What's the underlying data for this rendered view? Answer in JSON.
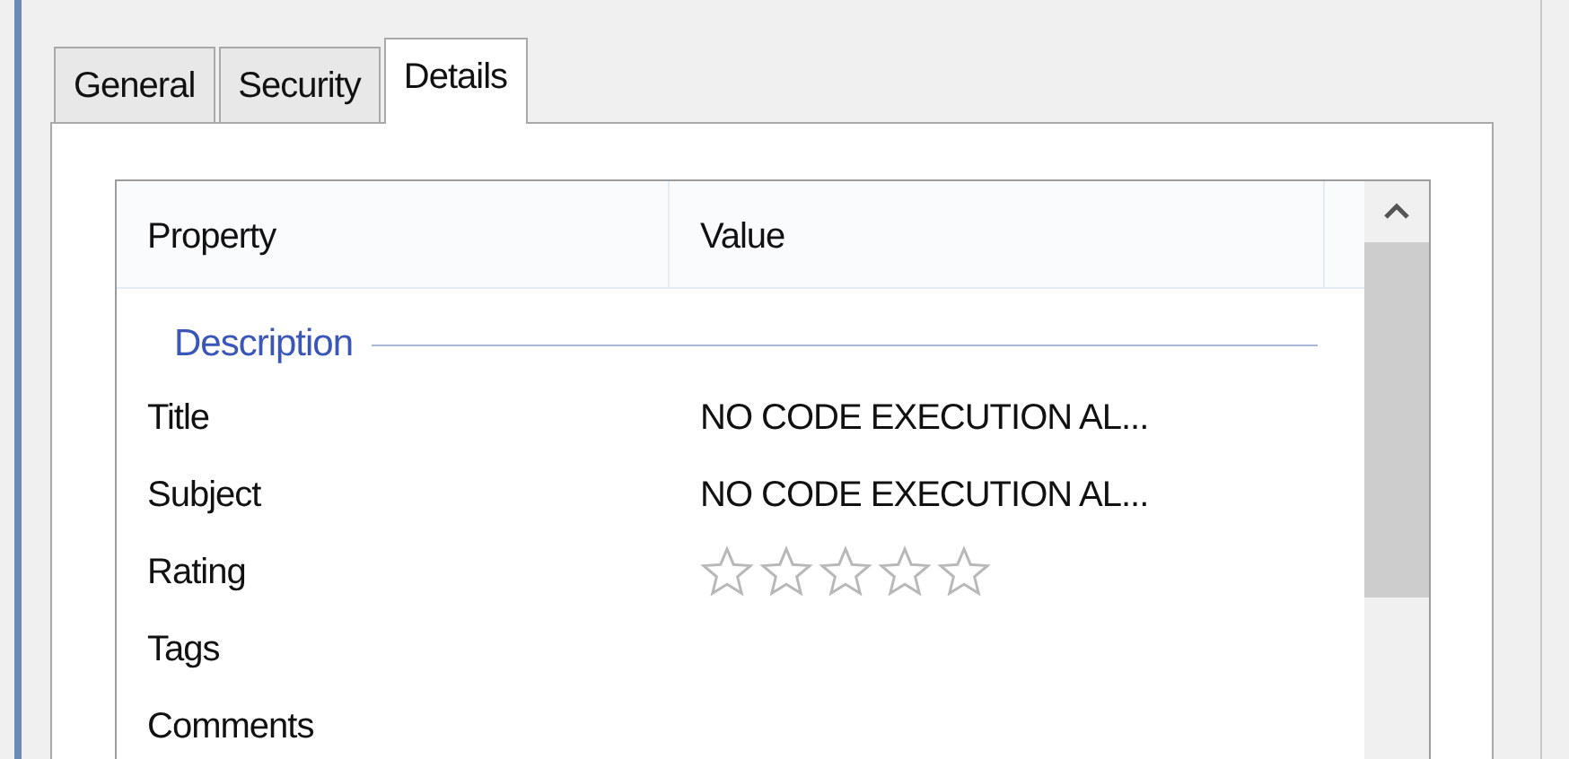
{
  "tabs": [
    {
      "label": "General",
      "selected": false
    },
    {
      "label": "Security",
      "selected": false
    },
    {
      "label": "Details",
      "selected": true
    }
  ],
  "list": {
    "columns": [
      "Property",
      "Value"
    ],
    "groups": [
      {
        "label": "Description",
        "rows": [
          {
            "kind": "text",
            "property": "Title",
            "value": "NO CODE EXECUTION AL..."
          },
          {
            "kind": "text",
            "property": "Subject",
            "value": "NO CODE EXECUTION AL..."
          },
          {
            "kind": "rating",
            "property": "Rating",
            "stars": 0
          },
          {
            "kind": "text",
            "property": "Tags"
          },
          {
            "kind": "text",
            "property": "Comments"
          }
        ]
      }
    ]
  }
}
